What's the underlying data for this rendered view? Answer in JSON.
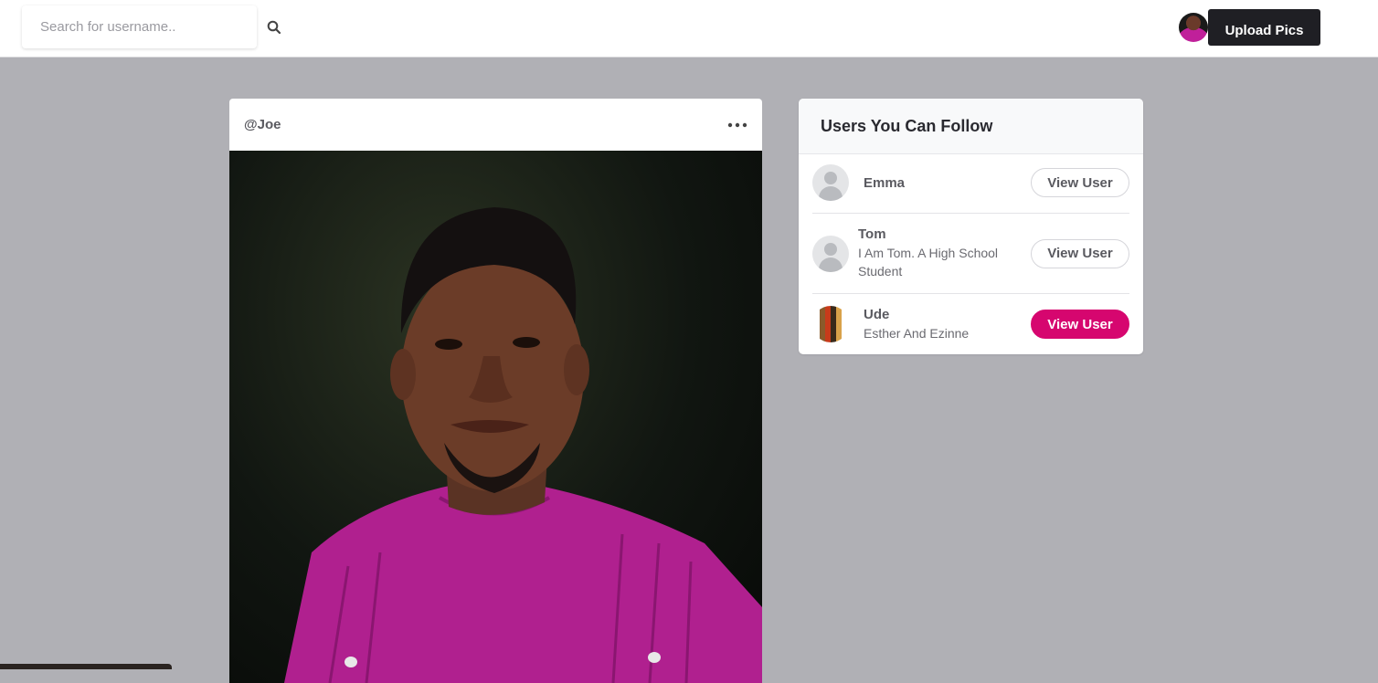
{
  "header": {
    "search_placeholder": "Search for username..",
    "upload_label": "Upload Pics"
  },
  "post": {
    "username": "@Joe"
  },
  "suggestions": {
    "title": "Users You Can Follow",
    "users": [
      {
        "name": "Emma",
        "bio": "",
        "button": "View User"
      },
      {
        "name": "Tom",
        "bio": "I Am Tom. A High School Student",
        "button": "View User"
      },
      {
        "name": "Ude",
        "bio": "Esther And Ezinne",
        "button": "View User"
      }
    ]
  },
  "colors": {
    "accent": "#d6066f",
    "upload_bg": "#1f1f24",
    "page_bg": "#b0b0b5"
  }
}
